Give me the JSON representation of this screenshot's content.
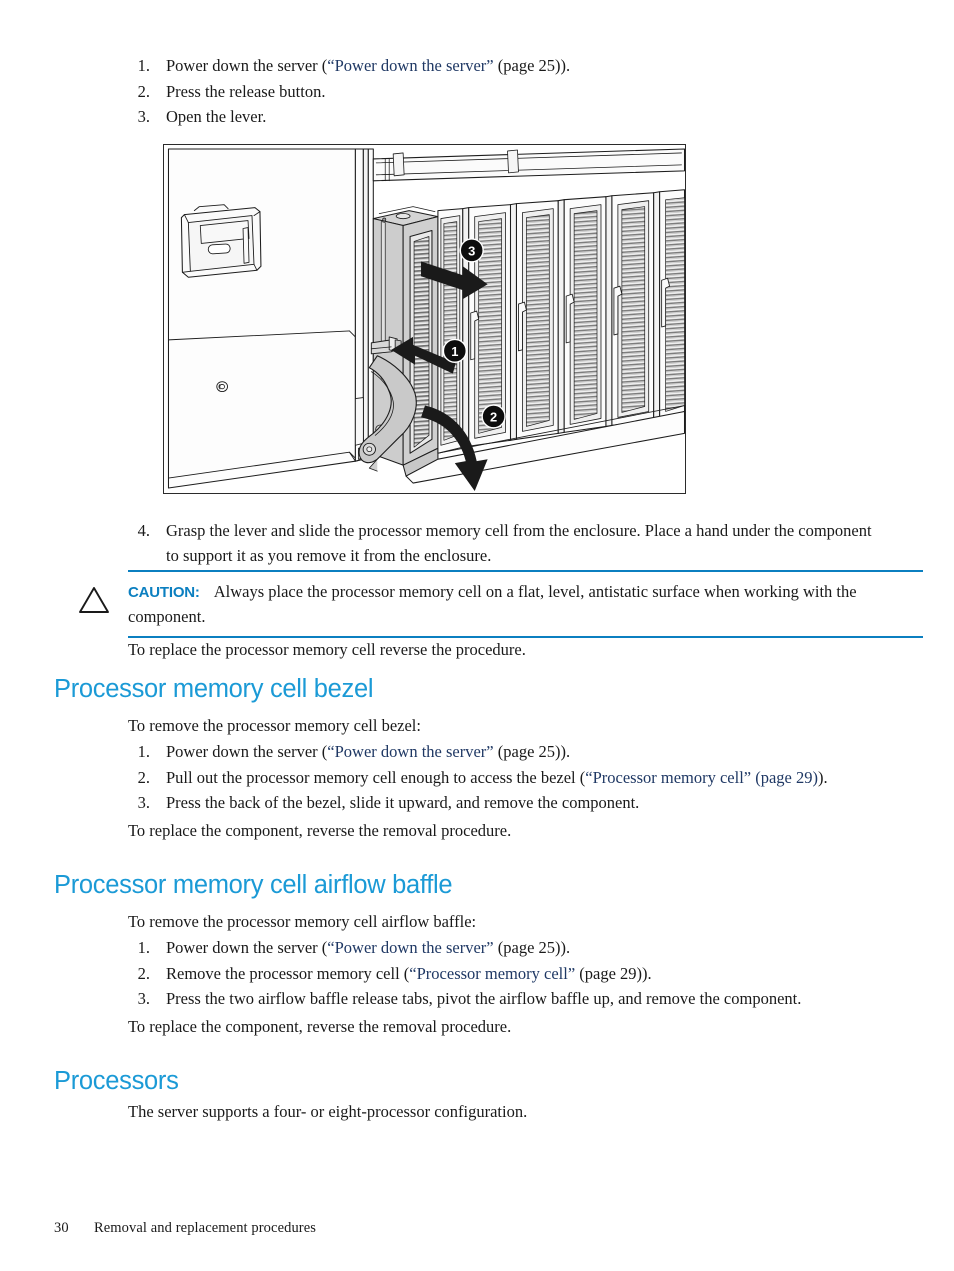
{
  "page": {
    "footer_page_number": "30",
    "footer_chapter": "Removal and replacement procedures"
  },
  "colors": {
    "heading_blue": "#1b9ad6",
    "caution_blue": "#0b7fc0",
    "xref_blue": "#1f3864",
    "rule_blue": "#0b7fc0",
    "text_black": "#1a1a1a"
  },
  "top_procedure": {
    "items": [
      {
        "num": "1.",
        "pre": "Power down the server (",
        "link": "“Power down the server”",
        "post": " (page 25))."
      },
      {
        "num": "2.",
        "pre": "Press the release button.",
        "link": "",
        "post": ""
      },
      {
        "num": "3.",
        "pre": "Open the lever.",
        "link": "",
        "post": ""
      }
    ]
  },
  "figure": {
    "alt": "Line illustration of a server enclosure with a processor memory cell partially extended, showing the release button, lever, and slide-out direction",
    "callouts": [
      {
        "label": "1",
        "meaning": "press-release-button"
      },
      {
        "label": "2",
        "meaning": "open-lever-downward"
      },
      {
        "label": "3",
        "meaning": "slide-cell-outward"
      }
    ]
  },
  "step4": {
    "num": "4.",
    "text": "Grasp the lever and slide the processor memory cell from the enclosure. Place a hand under the component to support it as you remove it from the enclosure."
  },
  "caution": {
    "icon": "warning-triangle",
    "label": "CAUTION:",
    "text": "Always place the processor memory cell on a flat, level, antistatic surface when working with the component."
  },
  "after_caution": {
    "text": "To replace the processor memory cell reverse the procedure."
  },
  "sections": [
    {
      "id": "bezel",
      "heading": "Processor memory cell bezel",
      "lead": "To remove the processor memory cell bezel:",
      "items": [
        {
          "num": "1.",
          "pre": "Power down the server (",
          "link": "“Power down the server”",
          "post": " (page 25))."
        },
        {
          "num": "2.",
          "pre": "Pull out the processor memory cell enough to access the bezel (",
          "link": "“Processor memory cell” (page 29)",
          "post": ")."
        },
        {
          "num": "3.",
          "pre": "Press the back of the bezel, slide it upward, and remove the component.",
          "link": "",
          "post": ""
        }
      ],
      "trail": "To replace the component, reverse the removal procedure."
    },
    {
      "id": "baffle",
      "heading": "Processor memory cell airflow baffle",
      "lead": "To remove the processor memory cell airflow baffle:",
      "items": [
        {
          "num": "1.",
          "pre": "Power down the server (",
          "link": "“Power down the server”",
          "post": " (page 25))."
        },
        {
          "num": "2.",
          "pre": "Remove the processor memory cell (",
          "link": "“Processor memory cell”",
          "post": " (page 29))."
        },
        {
          "num": "3.",
          "pre": "Press the two airflow baffle release tabs, pivot the airflow baffle up, and remove the component.",
          "link": "",
          "post": ""
        }
      ],
      "trail": "To replace the component, reverse the removal procedure."
    },
    {
      "id": "processors",
      "heading": "Processors",
      "lead": "The server supports a four- or eight-processor configuration.",
      "items": [],
      "trail": ""
    }
  ]
}
